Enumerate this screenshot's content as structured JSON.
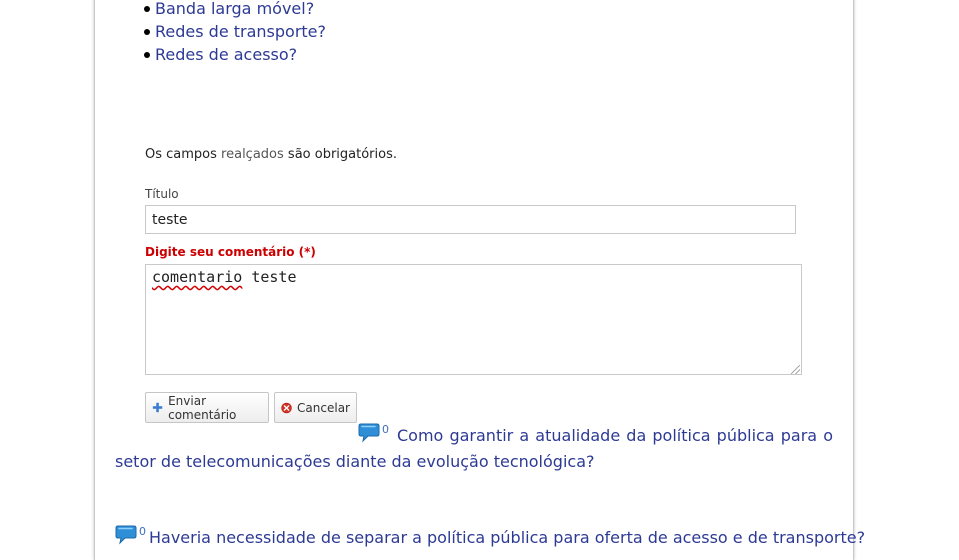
{
  "topics": [
    "Banda larga móvel?",
    "Redes de transporte?",
    "Redes de acesso?"
  ],
  "form": {
    "required_note_prefix": "Os campos",
    "required_note_highlight": "realçados",
    "required_note_suffix": "são obrigatórios.",
    "title_label": "Título",
    "title_value": "teste",
    "comment_label": "Digite seu comentário (*)",
    "comment_word_misspelled": "comentario",
    "comment_word_rest": " teste",
    "send_label": "Enviar comentário",
    "cancel_label": "Cancelar"
  },
  "questions": [
    {
      "count": "0",
      "text": "Como garantir a atualidade da política pública para o setor de telecomunicações diante da evolução tecnológica?"
    },
    {
      "count": "0",
      "text": "Haveria necessidade de separar a política pública para oferta de acesso e de transporte?"
    }
  ],
  "colors": {
    "link": "#2d3a94",
    "required_label": "#cc0000",
    "count": "#3b6fc1",
    "icon_blue": "#2e8fd6"
  },
  "icons": {
    "comment": "speech-bubble-icon",
    "plus": "plus-icon",
    "cancel": "cancel-x-icon"
  }
}
